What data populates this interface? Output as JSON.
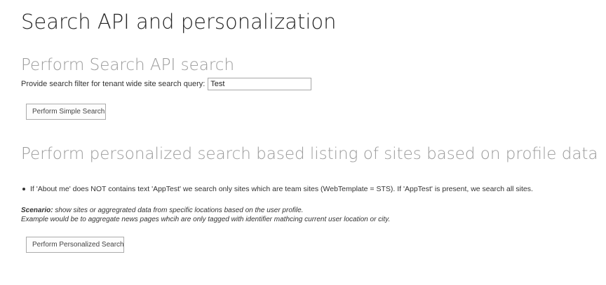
{
  "page": {
    "title": "Search API and personalization"
  },
  "search_section": {
    "heading": "Perform Search API search",
    "filter_label": "Provide search filter for tenant wide site search query:",
    "filter_value": "Test",
    "button_label": "Perform Simple Search"
  },
  "personal_section": {
    "heading": "Perform personalized search based listing of sites based on profile data",
    "bullets": [
      "If 'About me' does NOT contains text 'AppTest' we search only sites which are team sites (WebTemplate = STS). If 'AppTest' is present, we search all sites."
    ],
    "scenario_label": "Scenario:",
    "scenario_text": " show sites or aggregrated data from specific locations based on the user profile.",
    "example_text": "Example would be to aggregate news pages whcih are only tagged with identifier mathcing current user location or city.",
    "button_label": "Perform Personalized Search"
  }
}
